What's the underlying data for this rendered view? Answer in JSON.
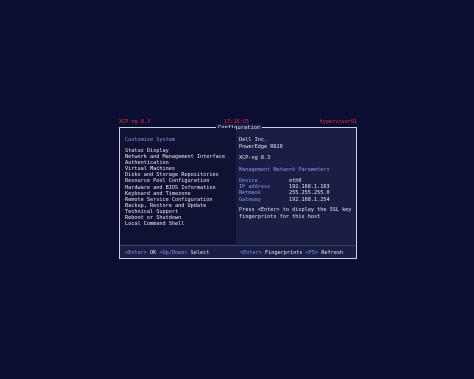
{
  "topbar": {
    "left": "XCP-ng 8.3",
    "center": "17:16:25",
    "right": "hypervisor01"
  },
  "dialog": {
    "title": "Configuration"
  },
  "menu": {
    "heading": "Customize System",
    "items": [
      "Status Display",
      "Network and Management Interface",
      "Authentication",
      "Virtual Machines",
      "Disks and Storage Repositories",
      "Resource Pool Configuration",
      "Hardware and BIOS Information",
      "Keyboard and Timezone",
      "Remote Service Configuration",
      "Backup, Restore and Update",
      "Technical Support",
      "Reboot or Shutdown",
      "Local Command Shell"
    ],
    "selected_index": 0
  },
  "status": {
    "vendor": "Dell Inc.",
    "model": "PowerEdge R620",
    "product": "XCP-ng 8.3",
    "network_heading": "Management Network Parameters",
    "params": [
      {
        "key": "Device",
        "value": "eth0"
      },
      {
        "key": "IP address",
        "value": "192.168.1.163"
      },
      {
        "key": "Netmask",
        "value": "255.255.255.0"
      },
      {
        "key": "Gateway",
        "value": "192.168.1.254"
      }
    ],
    "ssl_hint_line1": "Press <Enter> to display the SSL key",
    "ssl_hint_line2": "fingerprints for this host"
  },
  "footer": {
    "left_key1": "<Enter>",
    "left_label1": "OK",
    "left_key2": "<Up/Down>",
    "left_label2": "Select",
    "right_key1": "<Enter>",
    "right_label1": "Fingerprints",
    "right_key2": "<F5>",
    "right_label2": "Refresh"
  },
  "colors": {
    "background": "#0c0d33",
    "topbar_text": "#e3353d",
    "accent": "#8f98ea",
    "selected_bg": "#e8e9ee"
  }
}
